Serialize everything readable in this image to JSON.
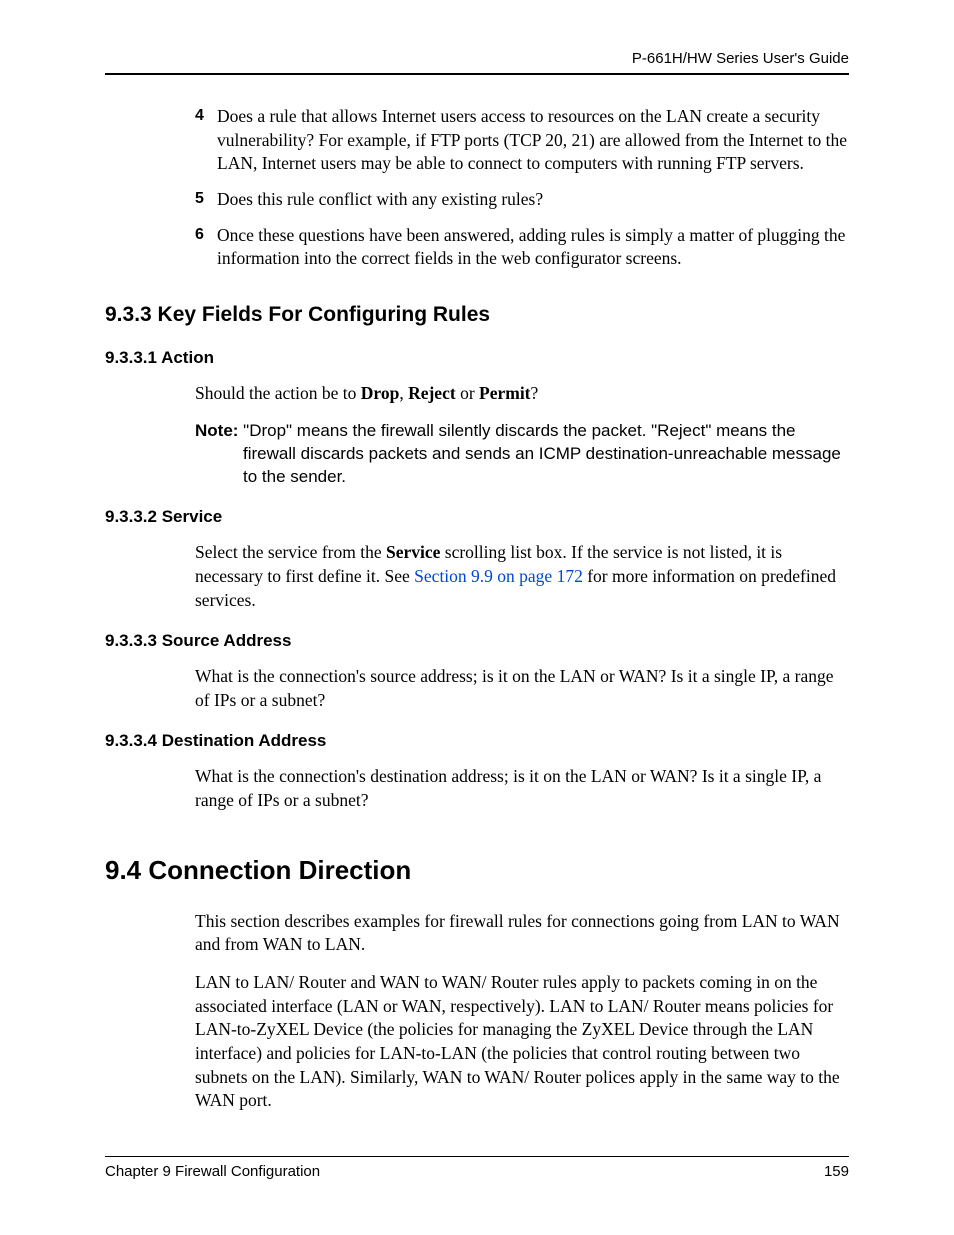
{
  "header": {
    "guide_title": "P-661H/HW Series User's Guide"
  },
  "list": {
    "item4": {
      "num": "4",
      "text": "Does a rule that allows Internet users access to resources on the LAN create a security vulnerability? For example, if FTP ports (TCP 20, 21) are allowed from the Internet to the LAN, Internet users may be able to connect to computers with running FTP servers."
    },
    "item5": {
      "num": "5",
      "text": "Does this rule conflict with any existing rules?"
    },
    "item6": {
      "num": "6",
      "text": "Once these questions have been answered, adding rules is simply a matter of plugging the information into the correct fields in the web configurator screens."
    }
  },
  "s933": {
    "heading": "9.3.3  Key Fields For Configuring Rules",
    "action": {
      "heading": "9.3.3.1  Action",
      "p_pre": "Should the action be to ",
      "drop": "Drop",
      "sep1": ", ",
      "reject": "Reject",
      "sep2": " or ",
      "permit": "Permit",
      "p_post": "?",
      "note_label": "Note: ",
      "note_line1": "\"Drop\" means the firewall silently discards the packet. \"Reject\" means the",
      "note_line2": "firewall discards packets and sends an ICMP destination-unreachable message to the sender."
    },
    "service": {
      "heading": "9.3.3.2  Service",
      "p_pre": "Select the service from the ",
      "bold": "Service",
      "p_mid": " scrolling list box. If the service is not listed, it is necessary to first define it. See ",
      "link": "Section 9.9 on page 172",
      "p_post": " for more information on predefined services."
    },
    "source": {
      "heading": "9.3.3.3  Source Address",
      "p": "What is the connection's source address; is it on the LAN or WAN? Is it a single IP, a range of IPs or a subnet?"
    },
    "dest": {
      "heading": "9.3.3.4  Destination Address",
      "p": "What is the connection's destination address; is it on the LAN or WAN? Is it a single IP, a range of IPs or a subnet?"
    }
  },
  "s94": {
    "heading": "9.4  Connection Direction",
    "p1": "This section describes examples for firewall rules for connections going from LAN to WAN and from WAN to LAN.",
    "p2": "LAN to LAN/ Router and WAN to WAN/ Router rules apply to packets coming in on the associated interface (LAN or WAN, respectively). LAN to LAN/ Router means policies for LAN-to-ZyXEL Device (the policies for managing the ZyXEL Device through the LAN interface) and policies for LAN-to-LAN (the policies that control routing between two subnets on the LAN). Similarly, WAN to WAN/ Router polices apply in the same way to the WAN port."
  },
  "footer": {
    "chapter": "Chapter 9 Firewall Configuration",
    "page": "159"
  }
}
